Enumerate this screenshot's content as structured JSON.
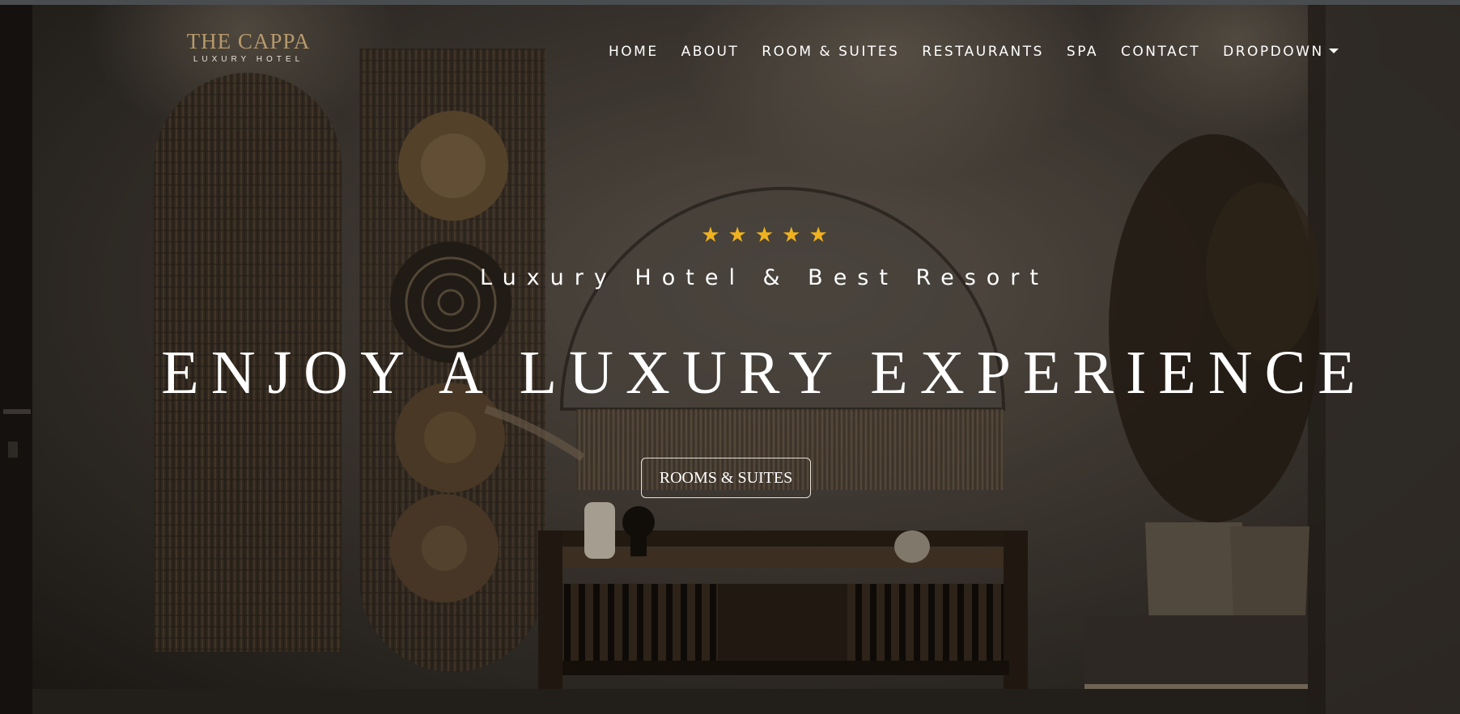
{
  "brand": {
    "name": "THE CAPPA",
    "tagline": "LUXURY HOTEL"
  },
  "nav": {
    "items": [
      {
        "label": "HOME"
      },
      {
        "label": "ABOUT"
      },
      {
        "label": "ROOM & SUITES"
      },
      {
        "label": "RESTAURANTS"
      },
      {
        "label": "SPA"
      },
      {
        "label": "CONTACT"
      },
      {
        "label": "DROPDOWN"
      }
    ]
  },
  "hero": {
    "rating": 5,
    "subtitle": "Luxury Hotel & Best Resort",
    "headline": "ENJOY A LUXURY EXPERIENCE",
    "cta_label": "ROOMS & SUITES"
  },
  "colors": {
    "brand_gold": "#b79a6b",
    "star": "#f0b21e",
    "text": "#ffffff"
  }
}
